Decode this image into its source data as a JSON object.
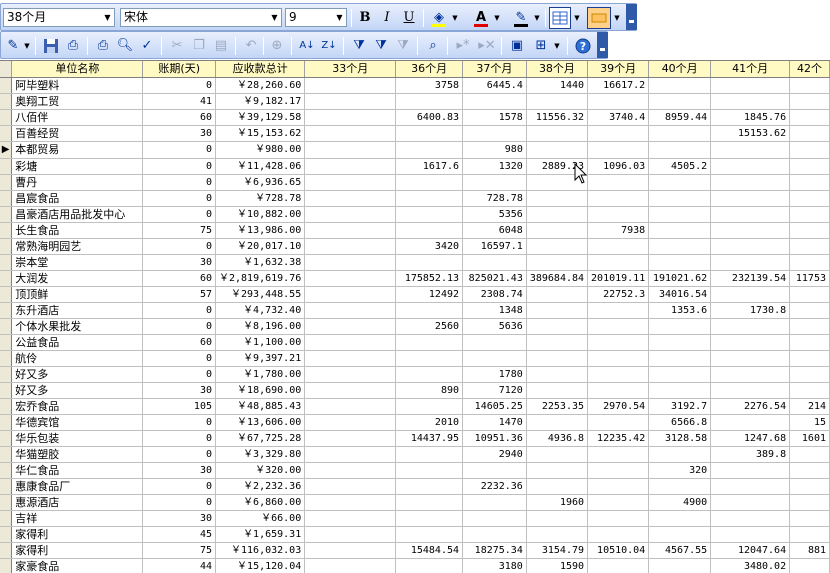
{
  "format_toolbar": {
    "font_size_combo": "38个月",
    "font_name": "宋体",
    "font_size": "9",
    "bold_label": "B",
    "italic_label": "I",
    "underline_label": "U",
    "font_color": "#e00000",
    "fill_color": "#ffff00",
    "line_color": "#000000"
  },
  "standard_toolbar": {
    "icons": [
      "edit-icon",
      "save-icon",
      "record-icon",
      "print-icon",
      "print-preview-icon",
      "spellcheck-icon",
      "cut-icon",
      "copy-icon",
      "paste-icon",
      "undo-icon",
      "hyperlink-icon",
      "sort-ascending-icon",
      "sort-descending-icon",
      "filter-selection-icon",
      "filter-form-icon",
      "apply-filter-icon",
      "find-icon",
      "new-record-icon",
      "delete-record-icon",
      "database-window-icon",
      "new-object-icon",
      "help-icon"
    ]
  },
  "grid": {
    "columns": [
      "单位名称",
      "账期(天)",
      "应收款总计",
      "33个月",
      "36个月",
      "37个月",
      "38个月",
      "39个月",
      "40个月",
      "41个月",
      "42个"
    ],
    "current_row_index": 4,
    "rows": [
      [
        "阿毕塑料",
        "0",
        "￥28,260.60",
        "",
        "3758",
        "6445.4",
        "1440",
        "16617.2",
        "",
        "",
        ""
      ],
      [
        "奥翔工贸",
        "41",
        "￥9,182.17",
        "",
        "",
        "",
        "",
        "",
        "",
        "",
        ""
      ],
      [
        "八佰伴",
        "60",
        "￥39,129.58",
        "",
        "6400.83",
        "1578",
        "11556.32",
        "3740.4",
        "8959.44",
        "1845.76",
        ""
      ],
      [
        "百善经贸",
        "30",
        "￥15,153.62",
        "",
        "",
        "",
        "",
        "",
        "",
        "15153.62",
        ""
      ],
      [
        "本都贸易",
        "0",
        "￥980.00",
        "",
        "",
        "980",
        "",
        "",
        "",
        "",
        ""
      ],
      [
        "彩塘",
        "0",
        "￥11,428.06",
        "",
        "1617.6",
        "1320",
        "2889.23",
        "1096.03",
        "4505.2",
        "",
        ""
      ],
      [
        "曹丹",
        "0",
        "￥6,936.65",
        "",
        "",
        "",
        "",
        "",
        "",
        "",
        ""
      ],
      [
        "昌宸食品",
        "0",
        "￥728.78",
        "",
        "",
        "728.78",
        "",
        "",
        "",
        "",
        ""
      ],
      [
        "昌豪酒店用品批发中心",
        "0",
        "￥10,882.00",
        "",
        "",
        "5356",
        "",
        "",
        "",
        "",
        ""
      ],
      [
        "长生食品",
        "75",
        "￥13,986.00",
        "",
        "",
        "6048",
        "",
        "7938",
        "",
        "",
        ""
      ],
      [
        "常熟海明园艺",
        "0",
        "￥20,017.10",
        "",
        "3420",
        "16597.1",
        "",
        "",
        "",
        "",
        ""
      ],
      [
        "崇本堂",
        "30",
        "￥1,632.38",
        "",
        "",
        "",
        "",
        "",
        "",
        "",
        ""
      ],
      [
        "大润发",
        "60",
        "￥2,819,619.76",
        "",
        "175852.13",
        "825021.43",
        "389684.84",
        "201019.11",
        "191021.62",
        "232139.54",
        "11753"
      ],
      [
        "顶顶鲜",
        "57",
        "￥293,448.55",
        "",
        "12492",
        "2308.74",
        "",
        "22752.3",
        "34016.54",
        "",
        ""
      ],
      [
        "东升酒店",
        "0",
        "￥4,732.40",
        "",
        "",
        "1348",
        "",
        "",
        "1353.6",
        "1730.8",
        ""
      ],
      [
        "个体水果批发",
        "0",
        "￥8,196.00",
        "",
        "2560",
        "5636",
        "",
        "",
        "",
        "",
        ""
      ],
      [
        "公益食品",
        "60",
        "￥1,100.00",
        "",
        "",
        "",
        "",
        "",
        "",
        "",
        ""
      ],
      [
        "航伶",
        "0",
        "￥9,397.21",
        "",
        "",
        "",
        "",
        "",
        "",
        "",
        ""
      ],
      [
        "好又多",
        "0",
        "￥1,780.00",
        "",
        "",
        "1780",
        "",
        "",
        "",
        "",
        ""
      ],
      [
        "好又多",
        "30",
        "￥18,690.00",
        "",
        "890",
        "7120",
        "",
        "",
        "",
        "",
        ""
      ],
      [
        "宏乔食品",
        "105",
        "￥48,885.43",
        "",
        "",
        "14605.25",
        "2253.35",
        "2970.54",
        "3192.7",
        "2276.54",
        "214"
      ],
      [
        "华德宾馆",
        "0",
        "￥13,606.00",
        "",
        "2010",
        "1470",
        "",
        "",
        "6566.8",
        "",
        "15"
      ],
      [
        "华乐包装",
        "0",
        "￥67,725.28",
        "",
        "14437.95",
        "10951.36",
        "4936.8",
        "12235.42",
        "3128.58",
        "1247.68",
        "1601"
      ],
      [
        "华猫塑胶",
        "0",
        "￥3,329.80",
        "",
        "",
        "2940",
        "",
        "",
        "",
        "389.8",
        ""
      ],
      [
        "华仁食品",
        "30",
        "￥320.00",
        "",
        "",
        "",
        "",
        "",
        "320",
        "",
        ""
      ],
      [
        "惠康食品厂",
        "0",
        "￥2,232.36",
        "",
        "",
        "2232.36",
        "",
        "",
        "",
        "",
        ""
      ],
      [
        "惠源酒店",
        "0",
        "￥6,860.00",
        "",
        "",
        "",
        "1960",
        "",
        "4900",
        "",
        ""
      ],
      [
        "吉祥",
        "30",
        "￥66.00",
        "",
        "",
        "",
        "",
        "",
        "",
        "",
        ""
      ],
      [
        "家得利",
        "45",
        "￥1,659.31",
        "",
        "",
        "",
        "",
        "",
        "",
        "",
        ""
      ],
      [
        "家得利",
        "75",
        "￥116,032.03",
        "",
        "15484.54",
        "18275.34",
        "3154.79",
        "10510.04",
        "4567.55",
        "12047.64",
        "881"
      ],
      [
        "家豪食品",
        "44",
        "￥15,120.04",
        "",
        "",
        "3180",
        "1590",
        "",
        "",
        "3480.02",
        ""
      ]
    ]
  }
}
